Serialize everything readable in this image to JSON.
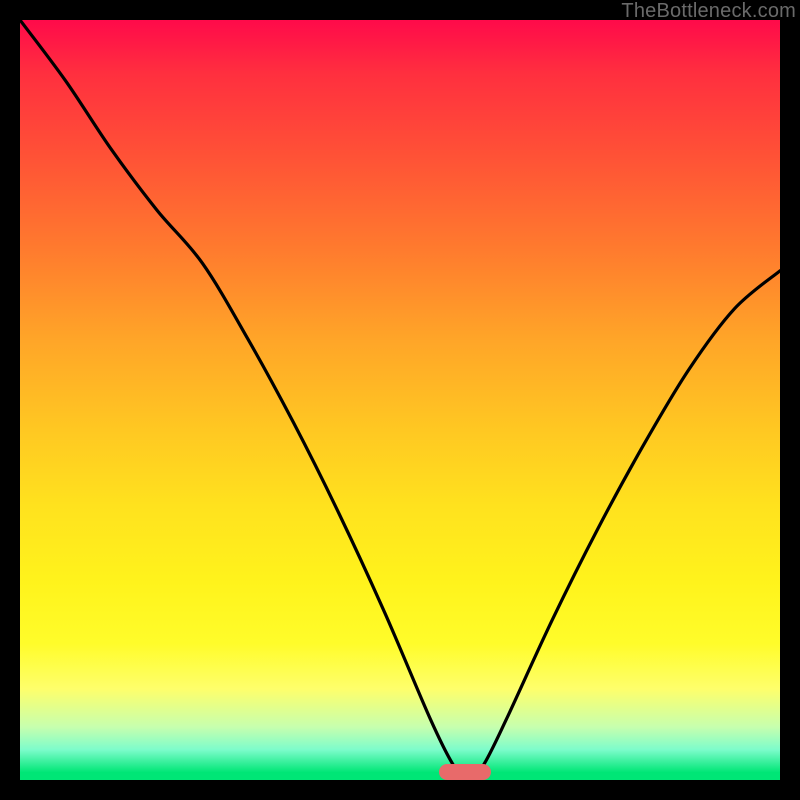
{
  "watermark": "TheBottleneck.com",
  "marker": {
    "x_pct": 58.5,
    "y_pct": 99.0,
    "color": "#e86a6a"
  },
  "chart_data": {
    "type": "line",
    "title": "",
    "xlabel": "",
    "ylabel": "",
    "xlim": [
      0,
      100
    ],
    "ylim": [
      0,
      100
    ],
    "grid": false,
    "series": [
      {
        "name": "bottleneck-curve",
        "x": [
          0,
          6,
          12,
          18,
          24,
          30,
          36,
          42,
          48,
          54,
          57,
          59,
          61,
          64,
          70,
          76,
          82,
          88,
          94,
          100
        ],
        "values": [
          100,
          92,
          83,
          75,
          68,
          58,
          47,
          35,
          22,
          8,
          2,
          0,
          2,
          8,
          21,
          33,
          44,
          54,
          62,
          67
        ]
      }
    ],
    "annotations": []
  }
}
